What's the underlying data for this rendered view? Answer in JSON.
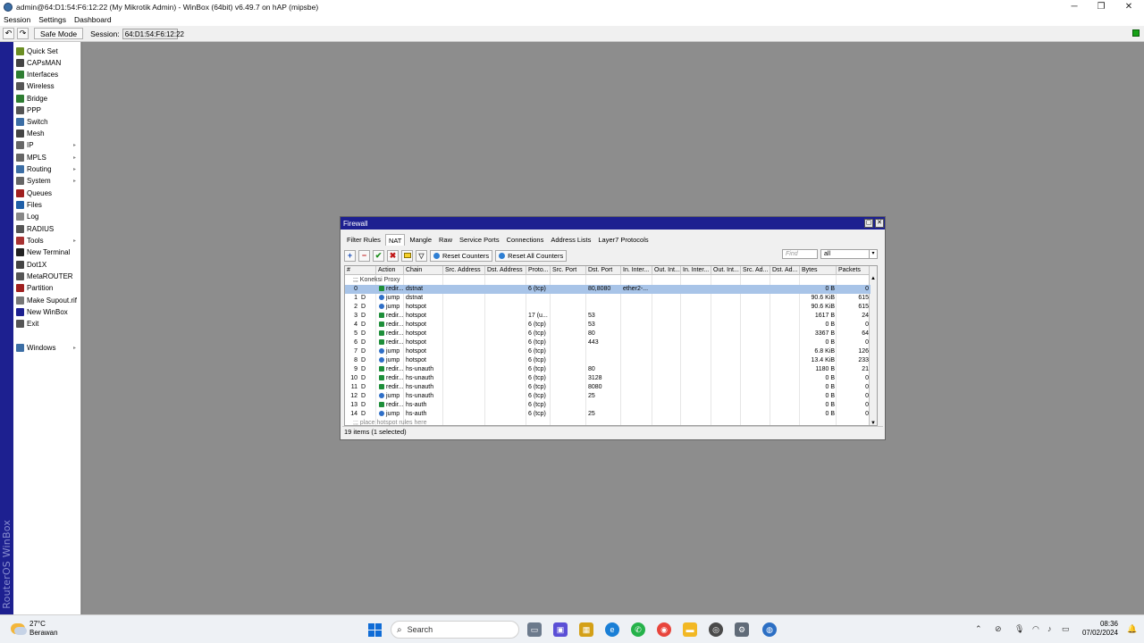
{
  "window": {
    "title": "admin@64:D1:54:F6:12:22 (My Mikrotik Admin) - WinBox (64bit) v6.49.7 on hAP (mipsbe)"
  },
  "menu": [
    "Session",
    "Settings",
    "Dashboard"
  ],
  "toolbar": {
    "undo": "↶",
    "redo": "↷",
    "safe_mode": "Safe Mode",
    "session_label": "Session:",
    "session_value": "64:D1:54:F6:12:22"
  },
  "sidebar": {
    "brand": "RouterOS WinBox",
    "items": [
      {
        "label": "Quick Set",
        "icon": "quickset-icon",
        "color": "#6b8e23",
        "submenu": false
      },
      {
        "label": "CAPsMAN",
        "icon": "capsman-icon",
        "color": "#444444",
        "submenu": false
      },
      {
        "label": "Interfaces",
        "icon": "interfaces-icon",
        "color": "#2e7d32",
        "submenu": false
      },
      {
        "label": "Wireless",
        "icon": "wireless-icon",
        "color": "#555555",
        "submenu": false
      },
      {
        "label": "Bridge",
        "icon": "bridge-icon",
        "color": "#2e7d32",
        "submenu": false
      },
      {
        "label": "PPP",
        "icon": "ppp-icon",
        "color": "#555555",
        "submenu": false
      },
      {
        "label": "Switch",
        "icon": "switch-icon",
        "color": "#3c6ea5",
        "submenu": false
      },
      {
        "label": "Mesh",
        "icon": "mesh-icon",
        "color": "#444444",
        "submenu": false
      },
      {
        "label": "IP",
        "icon": "ip-icon",
        "color": "#666666",
        "submenu": true
      },
      {
        "label": "MPLS",
        "icon": "mpls-icon",
        "color": "#666666",
        "submenu": true
      },
      {
        "label": "Routing",
        "icon": "routing-icon",
        "color": "#3c6ea5",
        "submenu": true
      },
      {
        "label": "System",
        "icon": "system-icon",
        "color": "#666666",
        "submenu": true
      },
      {
        "label": "Queues",
        "icon": "queues-icon",
        "color": "#a02020",
        "submenu": false
      },
      {
        "label": "Files",
        "icon": "files-icon",
        "color": "#1f5fa8",
        "submenu": false
      },
      {
        "label": "Log",
        "icon": "log-icon",
        "color": "#888888",
        "submenu": false
      },
      {
        "label": "RADIUS",
        "icon": "radius-icon",
        "color": "#555555",
        "submenu": false
      },
      {
        "label": "Tools",
        "icon": "tools-icon",
        "color": "#a83232",
        "submenu": true
      },
      {
        "label": "New Terminal",
        "icon": "terminal-icon",
        "color": "#222222",
        "submenu": false
      },
      {
        "label": "Dot1X",
        "icon": "dot1x-icon",
        "color": "#444444",
        "submenu": false
      },
      {
        "label": "MetaROUTER",
        "icon": "metarouter-icon",
        "color": "#555555",
        "submenu": false
      },
      {
        "label": "Partition",
        "icon": "partition-icon",
        "color": "#a02020",
        "submenu": false
      },
      {
        "label": "Make Supout.rif",
        "icon": "supout-icon",
        "color": "#777777",
        "submenu": false
      },
      {
        "label": "New WinBox",
        "icon": "winbox-icon",
        "color": "#1d2090",
        "submenu": false
      },
      {
        "label": "Exit",
        "icon": "exit-icon",
        "color": "#555555",
        "submenu": false
      },
      {
        "label": "Windows",
        "icon": "windows-icon",
        "color": "#3c6ea5",
        "submenu": true
      }
    ]
  },
  "firewall": {
    "title": "Firewall",
    "tabs": [
      "Filter Rules",
      "NAT",
      "Mangle",
      "Raw",
      "Service Ports",
      "Connections",
      "Address Lists",
      "Layer7 Protocols"
    ],
    "active_tab": "NAT",
    "buttons": {
      "reset_counters": "Reset Counters",
      "reset_all_counters": "Reset All Counters"
    },
    "find_placeholder": "Find",
    "filter_value": "all",
    "columns": [
      "#",
      "Action",
      "Chain",
      "Src. Address",
      "Dst. Address",
      "Proto...",
      "Src. Port",
      "Dst. Port",
      "In. Inter...",
      "Out. Int...",
      "In. Inter...",
      "Out. Int...",
      "Src. Ad...",
      "Dst. Ad...",
      "Bytes",
      "Packets"
    ],
    "comment_top": ";;; Koneksi Proxy",
    "comment_bottom": ";;; place hotspot rules here",
    "rows": [
      {
        "num": "0",
        "flag": "",
        "action": "redir...",
        "chain": "dstnat",
        "proto": "6 (tcp)",
        "dstport": "80,8080",
        "inif": "ether2-...",
        "bytes": "0 B",
        "packets": "0",
        "selected": true
      },
      {
        "num": "1",
        "flag": "D",
        "action": "jump",
        "chain": "dstnat",
        "proto": "",
        "dstport": "",
        "inif": "",
        "bytes": "90.6 KiB",
        "packets": "615",
        "selected": false
      },
      {
        "num": "2",
        "flag": "D",
        "action": "jump",
        "chain": "hotspot",
        "proto": "",
        "dstport": "",
        "inif": "",
        "bytes": "90.6 KiB",
        "packets": "615",
        "selected": false
      },
      {
        "num": "3",
        "flag": "D",
        "action": "redir...",
        "chain": "hotspot",
        "proto": "17 (u...",
        "dstport": "53",
        "inif": "",
        "bytes": "1617 B",
        "packets": "24",
        "selected": false
      },
      {
        "num": "4",
        "flag": "D",
        "action": "redir...",
        "chain": "hotspot",
        "proto": "6 (tcp)",
        "dstport": "53",
        "inif": "",
        "bytes": "0 B",
        "packets": "0",
        "selected": false
      },
      {
        "num": "5",
        "flag": "D",
        "action": "redir...",
        "chain": "hotspot",
        "proto": "6 (tcp)",
        "dstport": "80",
        "inif": "",
        "bytes": "3367 B",
        "packets": "64",
        "selected": false
      },
      {
        "num": "6",
        "flag": "D",
        "action": "redir...",
        "chain": "hotspot",
        "proto": "6 (tcp)",
        "dstport": "443",
        "inif": "",
        "bytes": "0 B",
        "packets": "0",
        "selected": false
      },
      {
        "num": "7",
        "flag": "D",
        "action": "jump",
        "chain": "hotspot",
        "proto": "6 (tcp)",
        "dstport": "",
        "inif": "",
        "bytes": "6.8 KiB",
        "packets": "126",
        "selected": false
      },
      {
        "num": "8",
        "flag": "D",
        "action": "jump",
        "chain": "hotspot",
        "proto": "6 (tcp)",
        "dstport": "",
        "inif": "",
        "bytes": "13.4 KiB",
        "packets": "233",
        "selected": false
      },
      {
        "num": "9",
        "flag": "D",
        "action": "redir...",
        "chain": "hs-unauth",
        "proto": "6 (tcp)",
        "dstport": "80",
        "inif": "",
        "bytes": "1180 B",
        "packets": "21",
        "selected": false
      },
      {
        "num": "10",
        "flag": "D",
        "action": "redir...",
        "chain": "hs-unauth",
        "proto": "6 (tcp)",
        "dstport": "3128",
        "inif": "",
        "bytes": "0 B",
        "packets": "0",
        "selected": false
      },
      {
        "num": "11",
        "flag": "D",
        "action": "redir...",
        "chain": "hs-unauth",
        "proto": "6 (tcp)",
        "dstport": "8080",
        "inif": "",
        "bytes": "0 B",
        "packets": "0",
        "selected": false
      },
      {
        "num": "12",
        "flag": "D",
        "action": "jump",
        "chain": "hs-unauth",
        "proto": "6 (tcp)",
        "dstport": "25",
        "inif": "",
        "bytes": "0 B",
        "packets": "0",
        "selected": false
      },
      {
        "num": "13",
        "flag": "D",
        "action": "redir...",
        "chain": "hs-auth",
        "proto": "6 (tcp)",
        "dstport": "",
        "inif": "",
        "bytes": "0 B",
        "packets": "0",
        "selected": false
      },
      {
        "num": "14",
        "flag": "D",
        "action": "jump",
        "chain": "hs-auth",
        "proto": "6 (tcp)",
        "dstport": "25",
        "inif": "",
        "bytes": "0 B",
        "packets": "0",
        "selected": false
      }
    ],
    "status": "19 items (1 selected)"
  },
  "taskbar": {
    "temperature": "27°C",
    "weather": "Berawan",
    "search_placeholder": "Search",
    "time": "08:36",
    "date": "07/02/2024"
  },
  "colors": {
    "winbox_blue": "#1d2090",
    "selection": "#a8c4e8",
    "status_green": "#17a117"
  }
}
